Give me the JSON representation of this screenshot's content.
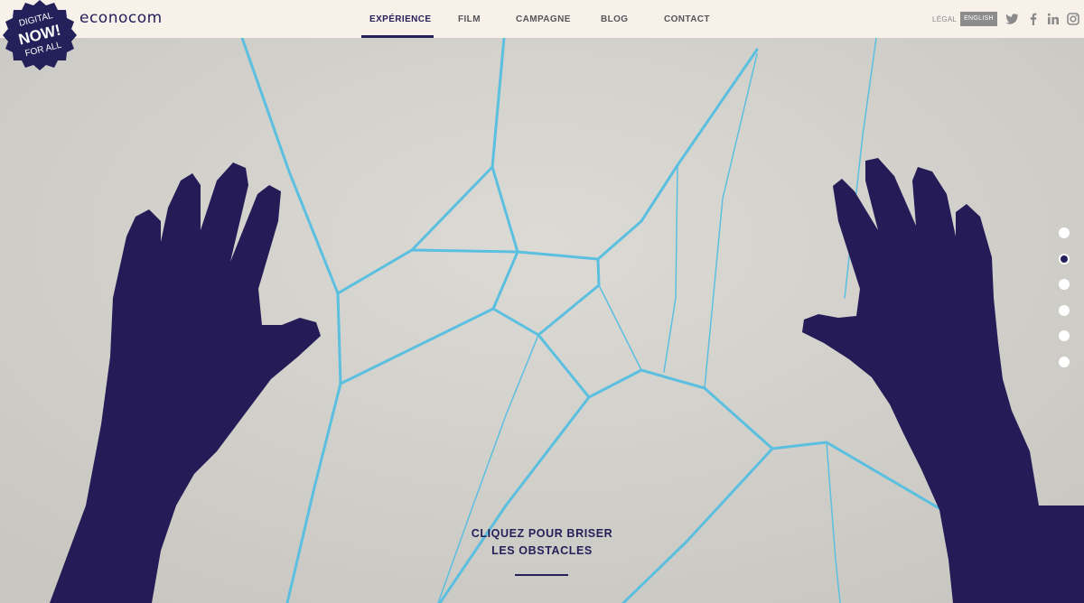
{
  "brand": {
    "name": "econocom",
    "badge_lines": [
      "DIGITAL",
      "NOW!",
      "FOR ALL"
    ]
  },
  "nav": {
    "items": [
      {
        "label": "EXPÉRIENCE",
        "active": true
      },
      {
        "label": "FILM",
        "active": false
      },
      {
        "label": "CAMPAGNE",
        "active": false
      },
      {
        "label": "BLOG",
        "active": false
      },
      {
        "label": "CONTACT",
        "active": false
      }
    ]
  },
  "utility": {
    "legal": "LÉGAL",
    "language": "ENGLISH",
    "social": [
      "twitter-icon",
      "facebook-icon",
      "linkedin-icon",
      "instagram-icon"
    ]
  },
  "slides": {
    "count": 6,
    "active_index": 1
  },
  "cta": {
    "line1": "CLIQUEZ POUR BRISER",
    "line2": "LES OBSTACLES"
  },
  "colors": {
    "header_bg": "#f7f1ea",
    "brand_navy": "#24205a",
    "crack_blue": "#5bbfe0",
    "background": "#d4d2cc"
  }
}
